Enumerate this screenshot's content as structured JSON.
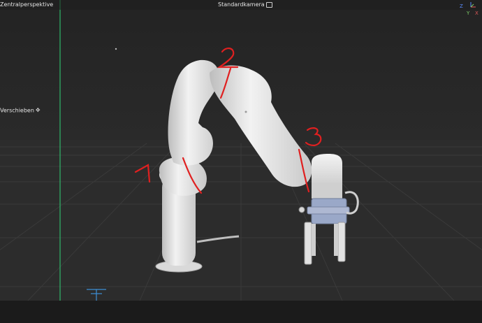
{
  "viewport": {
    "projection_label": "Zentralperspektive",
    "camera_label": "Standardkamera",
    "tool_label": "Verschieben"
  },
  "axis": {
    "z": "Z",
    "y": "Y",
    "x": "X"
  },
  "annotations": [
    "1",
    "2",
    "3"
  ],
  "colors": {
    "annotation": "#e02020",
    "robot": "#e8e8e8",
    "gripper_body": "#9aa8c8",
    "y_axis_line": "#2fb86a",
    "gizmo": "#3d8fd6"
  }
}
